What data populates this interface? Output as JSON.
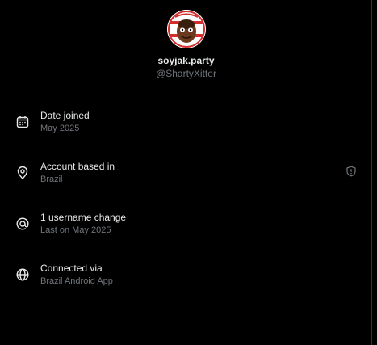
{
  "profile": {
    "display_name": "soyjak.party",
    "handle": "@ShartyXitter",
    "avatar_icon": "avatar-image"
  },
  "rows": [
    {
      "icon": "calendar-icon",
      "title": "Date joined",
      "subtitle": "May 2025"
    },
    {
      "icon": "location-pin-icon",
      "title": "Account based in",
      "subtitle": "Brazil",
      "badge_icon": "shield-info-icon"
    },
    {
      "icon": "at-sign-icon",
      "title": "1 username change",
      "subtitle": "Last on May 2025"
    },
    {
      "icon": "globe-icon",
      "title": "Connected via",
      "subtitle": "Brazil Android App"
    }
  ],
  "colors": {
    "background": "#000000",
    "primary_text": "#e7e9ea",
    "secondary_text": "#71767b",
    "border": "#2f3336"
  }
}
